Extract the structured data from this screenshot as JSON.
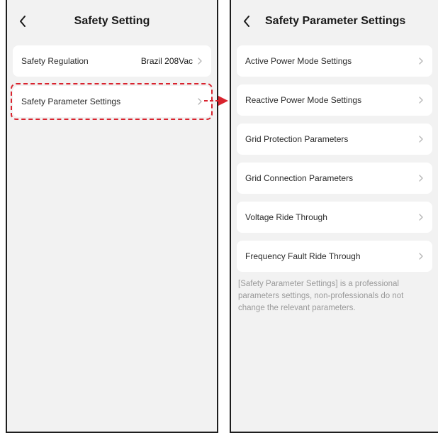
{
  "left": {
    "title": "Safety Setting",
    "items": [
      {
        "label": "Safety Regulation",
        "value": "Brazil 208Vac"
      },
      {
        "label": "Safety Parameter Settings",
        "value": ""
      }
    ]
  },
  "right": {
    "title": "Safety Parameter Settings",
    "items": [
      {
        "label": "Active Power Mode Settings"
      },
      {
        "label": "Reactive Power Mode Settings"
      },
      {
        "label": "Grid Protection Parameters"
      },
      {
        "label": "Grid Connection Parameters"
      },
      {
        "label": "Voltage Ride Through"
      },
      {
        "label": "Frequency Fault Ride Through"
      }
    ],
    "note": "[Safety Parameter Settings] is a professional parameters settings, non-professionals do not change the relevant parameters."
  },
  "colors": {
    "highlight": "#d9232e",
    "background": "#f2f2f2",
    "card": "#ffffff"
  },
  "icons": {
    "back": "chevron-left-icon",
    "row": "chevron-right-icon",
    "connector": "arrow-right-icon"
  }
}
